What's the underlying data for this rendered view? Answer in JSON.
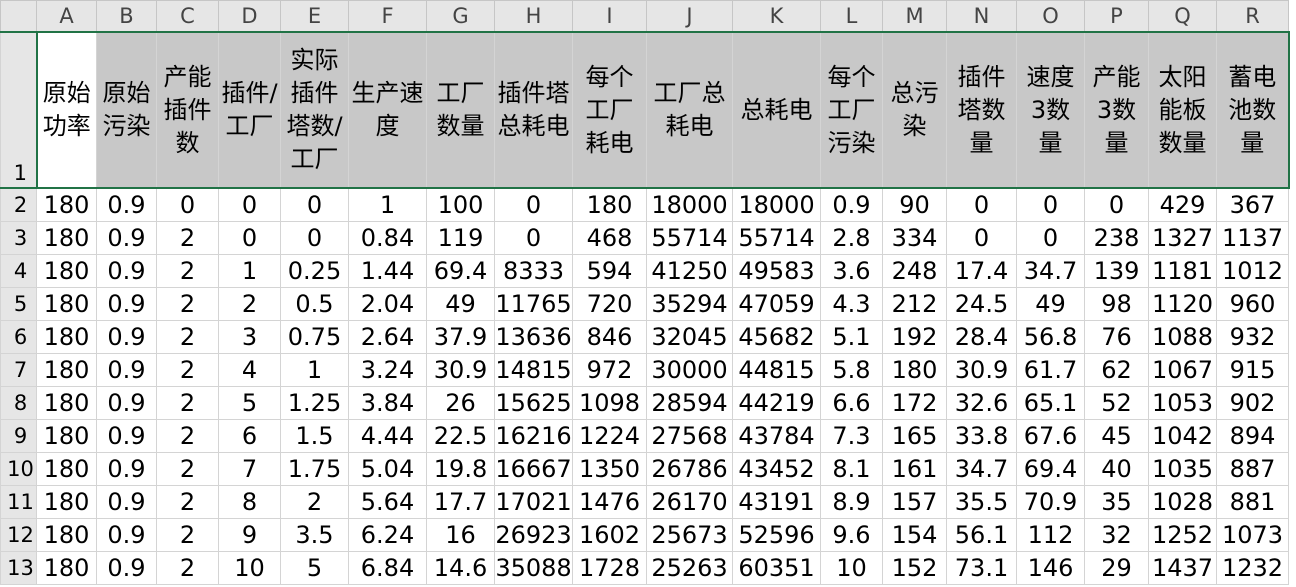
{
  "columns": [
    "A",
    "B",
    "C",
    "D",
    "E",
    "F",
    "G",
    "H",
    "I",
    "J",
    "K",
    "L",
    "M",
    "N",
    "O",
    "P",
    "Q",
    "R"
  ],
  "header_row_number": "1",
  "headers": [
    "原始功率",
    "原始污染",
    "产能插件数",
    "插件/工厂",
    "实际插件塔数/工厂",
    "生产速度",
    "工厂数量",
    "插件塔总耗电",
    "每个工厂耗电",
    "工厂总耗电",
    "总耗电",
    "每个工厂污染",
    "总污染",
    "插件塔数量",
    "速度3数量",
    "产能3数量",
    "太阳能板数量",
    "蓄电池数量"
  ],
  "rows": [
    {
      "num": "2",
      "cells": [
        "180",
        "0.9",
        "0",
        "0",
        "0",
        "1",
        "100",
        "0",
        "180",
        "18000",
        "18000",
        "0.9",
        "90",
        "0",
        "0",
        "0",
        "429",
        "367"
      ]
    },
    {
      "num": "3",
      "cells": [
        "180",
        "0.9",
        "2",
        "0",
        "0",
        "0.84",
        "119",
        "0",
        "468",
        "55714",
        "55714",
        "2.8",
        "334",
        "0",
        "0",
        "238",
        "1327",
        "1137"
      ]
    },
    {
      "num": "4",
      "cells": [
        "180",
        "0.9",
        "2",
        "1",
        "0.25",
        "1.44",
        "69.4",
        "8333",
        "594",
        "41250",
        "49583",
        "3.6",
        "248",
        "17.4",
        "34.7",
        "139",
        "1181",
        "1012"
      ]
    },
    {
      "num": "5",
      "cells": [
        "180",
        "0.9",
        "2",
        "2",
        "0.5",
        "2.04",
        "49",
        "11765",
        "720",
        "35294",
        "47059",
        "4.3",
        "212",
        "24.5",
        "49",
        "98",
        "1120",
        "960"
      ]
    },
    {
      "num": "6",
      "cells": [
        "180",
        "0.9",
        "2",
        "3",
        "0.75",
        "2.64",
        "37.9",
        "13636",
        "846",
        "32045",
        "45682",
        "5.1",
        "192",
        "28.4",
        "56.8",
        "76",
        "1088",
        "932"
      ]
    },
    {
      "num": "7",
      "cells": [
        "180",
        "0.9",
        "2",
        "4",
        "1",
        "3.24",
        "30.9",
        "14815",
        "972",
        "30000",
        "44815",
        "5.8",
        "180",
        "30.9",
        "61.7",
        "62",
        "1067",
        "915"
      ]
    },
    {
      "num": "8",
      "cells": [
        "180",
        "0.9",
        "2",
        "5",
        "1.25",
        "3.84",
        "26",
        "15625",
        "1098",
        "28594",
        "44219",
        "6.6",
        "172",
        "32.6",
        "65.1",
        "52",
        "1053",
        "902"
      ]
    },
    {
      "num": "9",
      "cells": [
        "180",
        "0.9",
        "2",
        "6",
        "1.5",
        "4.44",
        "22.5",
        "16216",
        "1224",
        "27568",
        "43784",
        "7.3",
        "165",
        "33.8",
        "67.6",
        "45",
        "1042",
        "894"
      ]
    },
    {
      "num": "10",
      "cells": [
        "180",
        "0.9",
        "2",
        "7",
        "1.75",
        "5.04",
        "19.8",
        "16667",
        "1350",
        "26786",
        "43452",
        "8.1",
        "161",
        "34.7",
        "69.4",
        "40",
        "1035",
        "887"
      ]
    },
    {
      "num": "11",
      "cells": [
        "180",
        "0.9",
        "2",
        "8",
        "2",
        "5.64",
        "17.7",
        "17021",
        "1476",
        "26170",
        "43191",
        "8.9",
        "157",
        "35.5",
        "70.9",
        "35",
        "1028",
        "881"
      ]
    },
    {
      "num": "12",
      "cells": [
        "180",
        "0.9",
        "2",
        "9",
        "3.5",
        "6.24",
        "16",
        "26923",
        "1602",
        "25673",
        "52596",
        "9.6",
        "154",
        "56.1",
        "112",
        "32",
        "1252",
        "1073"
      ]
    },
    {
      "num": "13",
      "cells": [
        "180",
        "0.9",
        "2",
        "10",
        "5",
        "6.84",
        "14.6",
        "35088",
        "1728",
        "25263",
        "60351",
        "10",
        "152",
        "73.1",
        "146",
        "29",
        "1437",
        "1232"
      ]
    }
  ]
}
